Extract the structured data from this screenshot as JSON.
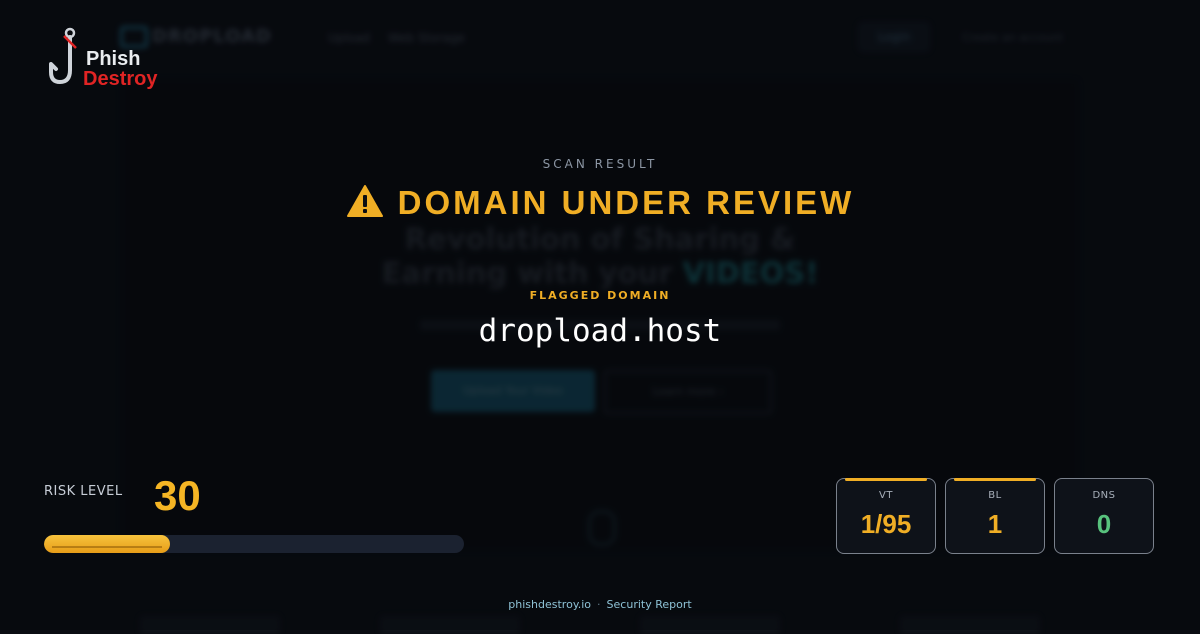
{
  "brand": {
    "word1": "Phish",
    "word2": "Destroy"
  },
  "background_site": {
    "logo": "DROPLOAD",
    "nav": [
      "Upload",
      "Web Storage"
    ],
    "login": "Login",
    "right": "Create an account",
    "headline_line1": "Revolution of Sharing &",
    "headline_line2_prefix": "Earning with your ",
    "headline_line2_accent": "VIDEOS!",
    "button_primary": "Upload Your Video",
    "button_secondary": "Learn more  ›"
  },
  "scan": {
    "label": "SCAN RESULT",
    "verdict": "DOMAIN UNDER REVIEW",
    "flag_label": "FLAGGED DOMAIN",
    "domain": "dropload.host"
  },
  "risk": {
    "label": "RISK LEVEL",
    "value": "30",
    "fraction": 0.3
  },
  "stats": [
    {
      "label": "VT",
      "value": "1/95",
      "color": "#f0ae25",
      "accent": true
    },
    {
      "label": "BL",
      "value": "1",
      "color": "#f0ae25",
      "accent": true
    },
    {
      "label": "DNS",
      "value": "0",
      "color": "#58c27d",
      "accent": false
    }
  ],
  "footer": {
    "site": "phishdestroy.io",
    "sep": "·",
    "report": "Security Report"
  },
  "colors": {
    "warning": "#f0ae25",
    "brand_red": "#e02424",
    "safe": "#58c27d"
  }
}
